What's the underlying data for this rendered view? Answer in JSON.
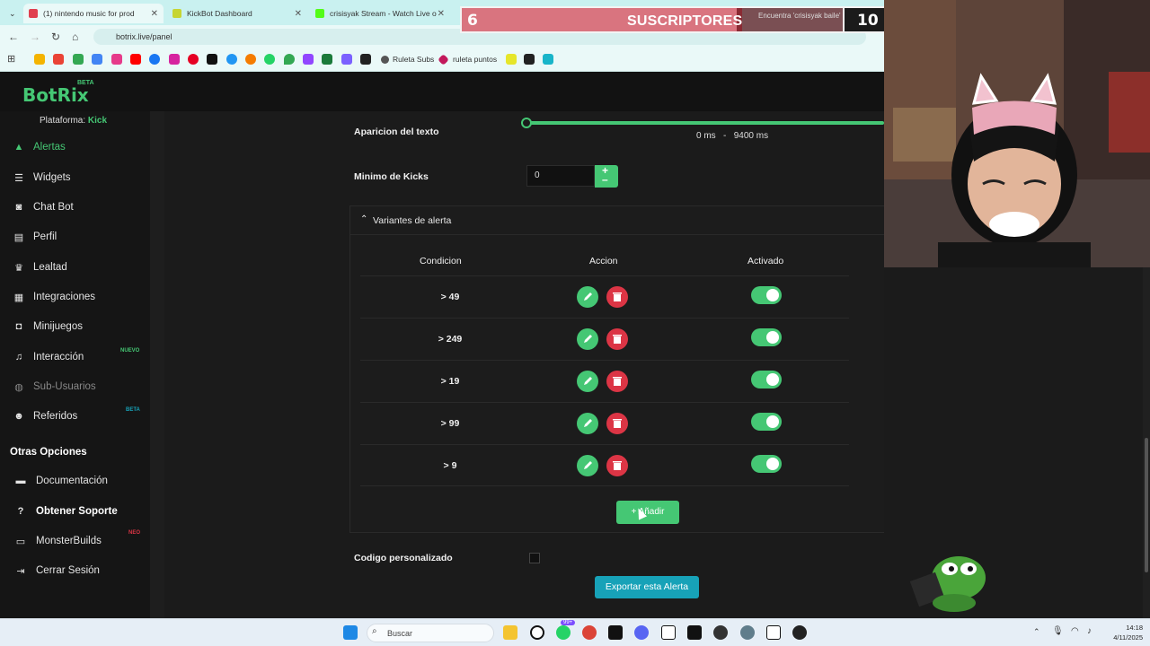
{
  "browser": {
    "tabs": [
      {
        "title": "(1) nintendo music for prod",
        "color": "#e03f4f"
      },
      {
        "title": "KickBot Dashboard",
        "color": "#c6d532"
      },
      {
        "title": "crisisyak Stream - Watch Live o",
        "color": "#53fc18"
      },
      {
        "title": "Encuentra 'crisisyak baile' en TikTok",
        "color": "#111111"
      }
    ],
    "url": "botrix.live/panel",
    "bookmarks": [
      {
        "label": "Ruleta Subs"
      },
      {
        "label": "ruleta puntos"
      }
    ]
  },
  "overlay": {
    "left_number": "6",
    "label": "SUSCRIPTORES",
    "right_number": "10"
  },
  "app": {
    "logo": "BotRix",
    "logo_badge": "BETA",
    "platform_label": "Plataforma:",
    "platform_value": "Kick"
  },
  "sidebar": {
    "items": [
      {
        "label": "Alertas",
        "icon": "warning-icon"
      },
      {
        "label": "Widgets",
        "icon": "list-icon"
      },
      {
        "label": "Chat Bot",
        "icon": "robot-icon"
      },
      {
        "label": "Perfil",
        "icon": "id-card-icon"
      },
      {
        "label": "Lealtad",
        "icon": "trophy-icon"
      },
      {
        "label": "Integraciones",
        "icon": "table-icon"
      },
      {
        "label": "Minijuegos",
        "icon": "gamepad-icon"
      },
      {
        "label": "Interacción",
        "icon": "music-icon",
        "badge": "NUEVO"
      },
      {
        "label": "Sub-Usuarios",
        "icon": "users-icon"
      },
      {
        "label": "Referidos",
        "icon": "user-group-icon",
        "badge": "BETA"
      }
    ],
    "section_title": "Otras Opciones",
    "other_items": [
      {
        "label": "Documentación",
        "icon": "book-icon"
      },
      {
        "label": "Obtener Soporte",
        "icon": "help-icon"
      },
      {
        "label": "MonsterBuilds",
        "icon": "laptop-icon",
        "badge": "NEO"
      },
      {
        "label": "Cerrar Sesión",
        "icon": "logout-icon"
      }
    ]
  },
  "form": {
    "text_appearance_label": "Aparicion del texto",
    "range_min": "0",
    "range_max": "9400",
    "range_unit": "ms",
    "range_sep": "-",
    "min_kicks_label": "Minimo de Kicks",
    "min_kicks_value": "0",
    "custom_code_label": "Codigo personalizado",
    "export_label": "Exportar esta Alerta"
  },
  "variants": {
    "title": "Variantes de alerta",
    "columns": [
      "Condicion",
      "Accion",
      "Activado"
    ],
    "rows": [
      {
        "condition": "> 49",
        "enabled": true
      },
      {
        "condition": "> 249",
        "enabled": true
      },
      {
        "condition": "> 19",
        "enabled": true
      },
      {
        "condition": "> 99",
        "enabled": true
      },
      {
        "condition": "> 9",
        "enabled": true
      }
    ],
    "add_label": "Añadir"
  },
  "taskbar": {
    "search_placeholder": "Buscar",
    "time": "14:18",
    "date": "4/11/2025",
    "badge": "99+"
  },
  "colors": {
    "accent": "#45c774",
    "danger": "#dc3545",
    "info": "#17a2b8"
  }
}
